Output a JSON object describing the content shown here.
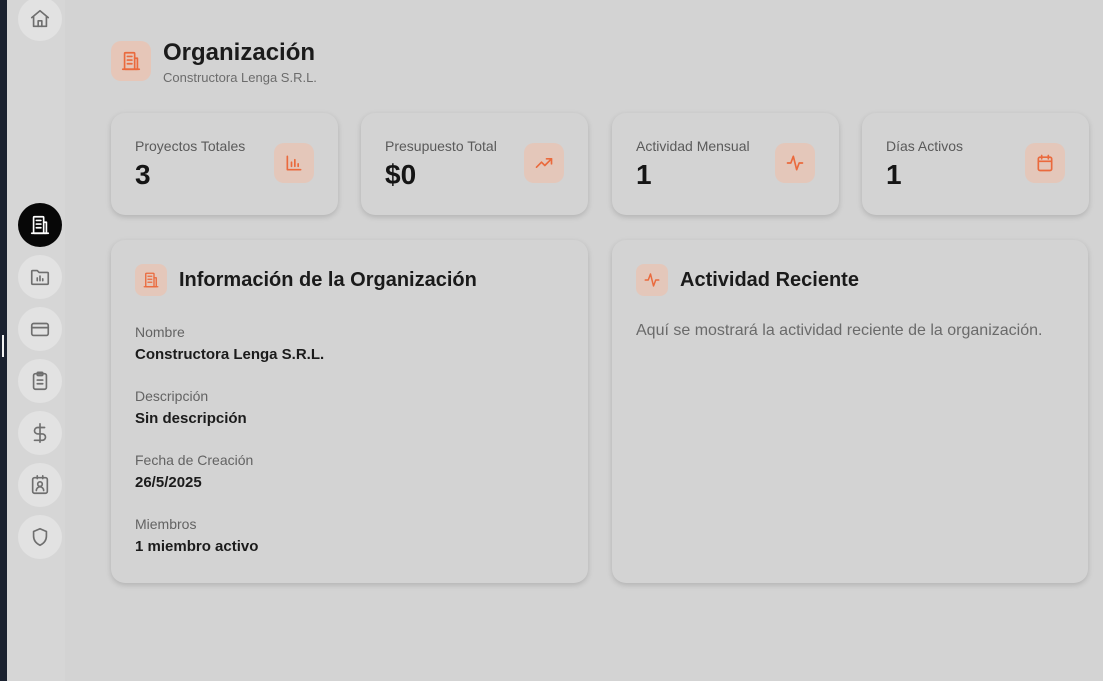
{
  "sidebar": {
    "items": [
      {
        "icon": "home-icon",
        "active": false
      },
      {
        "icon": "building-icon",
        "active": true
      },
      {
        "icon": "folder-chart-icon",
        "active": false
      },
      {
        "icon": "credit-card-icon",
        "active": false
      },
      {
        "icon": "clipboard-icon",
        "active": false
      },
      {
        "icon": "dollar-icon",
        "active": false
      },
      {
        "icon": "contact-icon",
        "active": false
      },
      {
        "icon": "shield-icon",
        "active": false
      }
    ]
  },
  "header": {
    "icon": "building-icon",
    "title": "Organización",
    "subtitle": "Constructora Lenga S.R.L."
  },
  "stats": [
    {
      "label": "Proyectos Totales",
      "value": "3",
      "icon": "bar-chart-icon"
    },
    {
      "label": "Presupuesto Total",
      "value": "$0",
      "icon": "trending-up-icon"
    },
    {
      "label": "Actividad Mensual",
      "value": "1",
      "icon": "activity-icon"
    },
    {
      "label": "Días Activos",
      "value": "1",
      "icon": "calendar-icon"
    }
  ],
  "org_info": {
    "icon": "building-icon",
    "title": "Información de la Organización",
    "fields": [
      {
        "label": "Nombre",
        "value": "Constructora Lenga S.R.L."
      },
      {
        "label": "Descripción",
        "value": "Sin descripción"
      },
      {
        "label": "Fecha de Creación",
        "value": "26/5/2025"
      },
      {
        "label": "Miembros",
        "value": "1 miembro activo"
      }
    ]
  },
  "recent_activity": {
    "icon": "activity-icon",
    "title": "Actividad Reciente",
    "text": "Aquí se mostrará la actividad reciente de la organización."
  },
  "colors": {
    "accent": "#ea6a3d",
    "accent_bg": "#e4c7ba",
    "background": "#d3d3d3",
    "active_nav": "#070707"
  }
}
